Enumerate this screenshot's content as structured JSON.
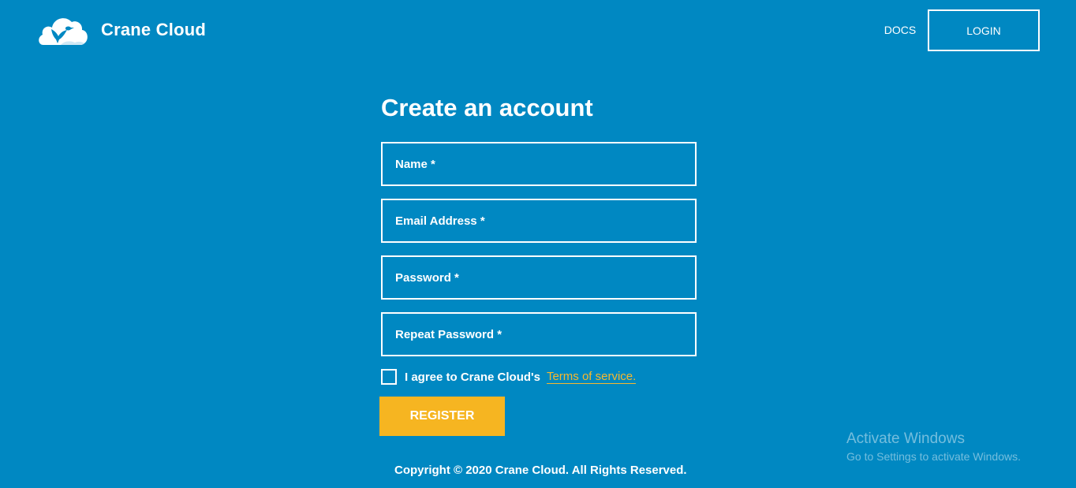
{
  "brand": {
    "name": "Crane Cloud",
    "logo_icon": "cloud-bird-icon"
  },
  "nav": {
    "docs_label": "DOCS",
    "login_label": "LOGIN"
  },
  "form": {
    "title": "Create an account",
    "fields": [
      {
        "label": "Name *",
        "value": ""
      },
      {
        "label": "Email Address *",
        "value": ""
      },
      {
        "label": "Password *",
        "value": ""
      },
      {
        "label": "Repeat Password *",
        "value": ""
      }
    ],
    "terms_text": "I agree to Crane Cloud's",
    "terms_link": "Terms of service.",
    "terms_checked": false,
    "register_label": "REGISTER"
  },
  "footer": {
    "copyright": "Copyright © 2020 Crane Cloud. All Rights Reserved."
  },
  "watermark": {
    "title": "Activate Windows",
    "subtitle": "Go to Settings to activate Windows."
  },
  "colors": {
    "background": "#0088c2",
    "accent": "#f6b521",
    "link": "#f7b82e",
    "text": "#ffffff"
  }
}
